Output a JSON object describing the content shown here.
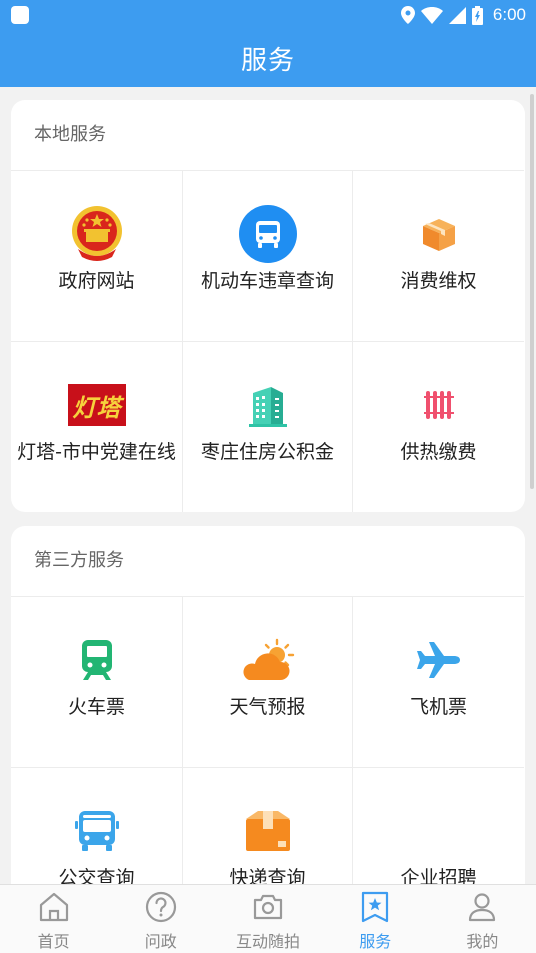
{
  "status_bar": {
    "time": "6:00"
  },
  "header": {
    "title": "服务"
  },
  "sections": [
    {
      "title": "本地服务",
      "items": [
        {
          "label": "政府网站",
          "icon": "national-emblem-icon"
        },
        {
          "label": "机动车违章查询",
          "icon": "bus-icon"
        },
        {
          "label": "消费维权",
          "icon": "box-icon"
        },
        {
          "label": "灯塔-市中党建在线",
          "icon": "dengta-logo-icon",
          "logo_text": "灯塔"
        },
        {
          "label": "枣庄住房公积金",
          "icon": "building-icon"
        },
        {
          "label": "供热缴费",
          "icon": "radiator-icon"
        }
      ]
    },
    {
      "title": "第三方服务",
      "items": [
        {
          "label": "火车票",
          "icon": "train-icon"
        },
        {
          "label": "天气预报",
          "icon": "weather-icon"
        },
        {
          "label": "飞机票",
          "icon": "airplane-icon"
        },
        {
          "label": "公交查询",
          "icon": "bus-front-icon"
        },
        {
          "label": "快递查询",
          "icon": "package-icon"
        },
        {
          "label": "企业招聘",
          "icon": ""
        }
      ]
    }
  ],
  "tabs": [
    {
      "label": "首页",
      "icon": "home-icon"
    },
    {
      "label": "问政",
      "icon": "question-icon"
    },
    {
      "label": "互动随拍",
      "icon": "camera-icon"
    },
    {
      "label": "服务",
      "icon": "bookmark-star-icon",
      "active": true
    },
    {
      "label": "我的",
      "icon": "user-icon"
    }
  ],
  "colors": {
    "primary": "#3d9cf0",
    "inactive_tab": "#888888"
  }
}
